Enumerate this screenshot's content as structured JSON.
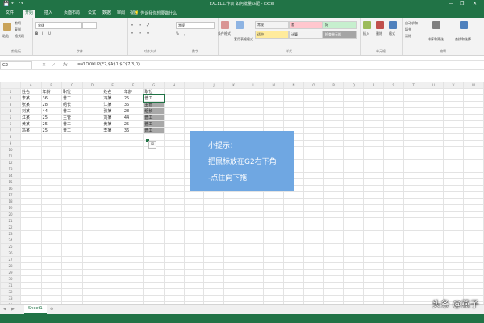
{
  "window": {
    "title": "EXCEL工作表 如何批量匹配 - Excel",
    "quick_access": [
      "💾",
      "↶",
      "↷"
    ],
    "controls": [
      "—",
      "❐",
      "✕"
    ]
  },
  "tabs": [
    {
      "label": "文件"
    },
    {
      "label": "开始"
    },
    {
      "label": "插入"
    },
    {
      "label": "页面布局"
    },
    {
      "label": "公式"
    },
    {
      "label": "数据"
    },
    {
      "label": "审阅"
    },
    {
      "label": "视图"
    }
  ],
  "search_hint": "告诉我你想要做什么",
  "ribbon": {
    "groups": [
      "剪贴板",
      "字体",
      "对齐方式",
      "数字",
      "样式",
      "单元格",
      "编辑"
    ],
    "font_name": "宋体",
    "number_format": "常规",
    "style_cells": [
      {
        "label": "常规",
        "bg": "#ffffff"
      },
      {
        "label": "差",
        "bg": "#ffc7ce"
      },
      {
        "label": "好",
        "bg": "#c6efce"
      },
      {
        "label": "适中",
        "bg": "#ffeb9c"
      },
      {
        "label": "计算",
        "bg": "#f2f2f2"
      },
      {
        "label": "检查单元格",
        "bg": "#a5a5a5"
      }
    ],
    "cell_buttons": [
      "插入",
      "删除",
      "格式"
    ],
    "edit_buttons": [
      "自动求和",
      "填充",
      "清除",
      "排序和筛选",
      "查找和选择"
    ],
    "clip_buttons": [
      "粘贴",
      "剪切",
      "复制",
      "格式刷"
    ],
    "big_buttons": [
      "条件格式",
      "套用表格格式",
      "单元格样式"
    ]
  },
  "formula_bar": {
    "name_box": "G2",
    "fx": "fx",
    "formula": "=VLOOKUP(E2,$A$1:$C$7,3,0)"
  },
  "columns": [
    "A",
    "B",
    "C",
    "D",
    "E",
    "F",
    "G",
    "H",
    "I",
    "J",
    "K",
    "L",
    "M",
    "N",
    "O",
    "P",
    "Q",
    "R",
    "S",
    "T",
    "U",
    "V",
    "W"
  ],
  "rows": [
    [
      "姓名",
      "年龄",
      "职位",
      "",
      "姓名",
      "年龄",
      "职位"
    ],
    [
      "李某",
      "36",
      "普工",
      "",
      "冯某",
      "25",
      "普工"
    ],
    [
      "张某",
      "28",
      "组长",
      "",
      "江某",
      "36",
      "主管"
    ],
    [
      "刘某",
      "44",
      "普工",
      "",
      "张某",
      "28",
      "组长"
    ],
    [
      "江某",
      "25",
      "主管",
      "",
      "刘某",
      "44",
      "普工"
    ],
    [
      "黄某",
      "25",
      "普工",
      "",
      "黄某",
      "25",
      "普工"
    ],
    [
      "冯某",
      "25",
      "普工",
      "",
      "李某",
      "36",
      "普工"
    ]
  ],
  "total_rows": 35,
  "tip": {
    "line1": "小提示：",
    "line2": "把鼠标放在G2右下角",
    "line3": "-点住向下拖"
  },
  "sheet": {
    "tab_label": "Sheet1",
    "nav_left": "◀",
    "nav_right": "▶",
    "add": "⊕"
  },
  "watermark": "头条 @燕子",
  "colors": {
    "excel_green": "#217346",
    "tip_bg": "#6fa7e2",
    "selection": "#a8a8a8"
  }
}
